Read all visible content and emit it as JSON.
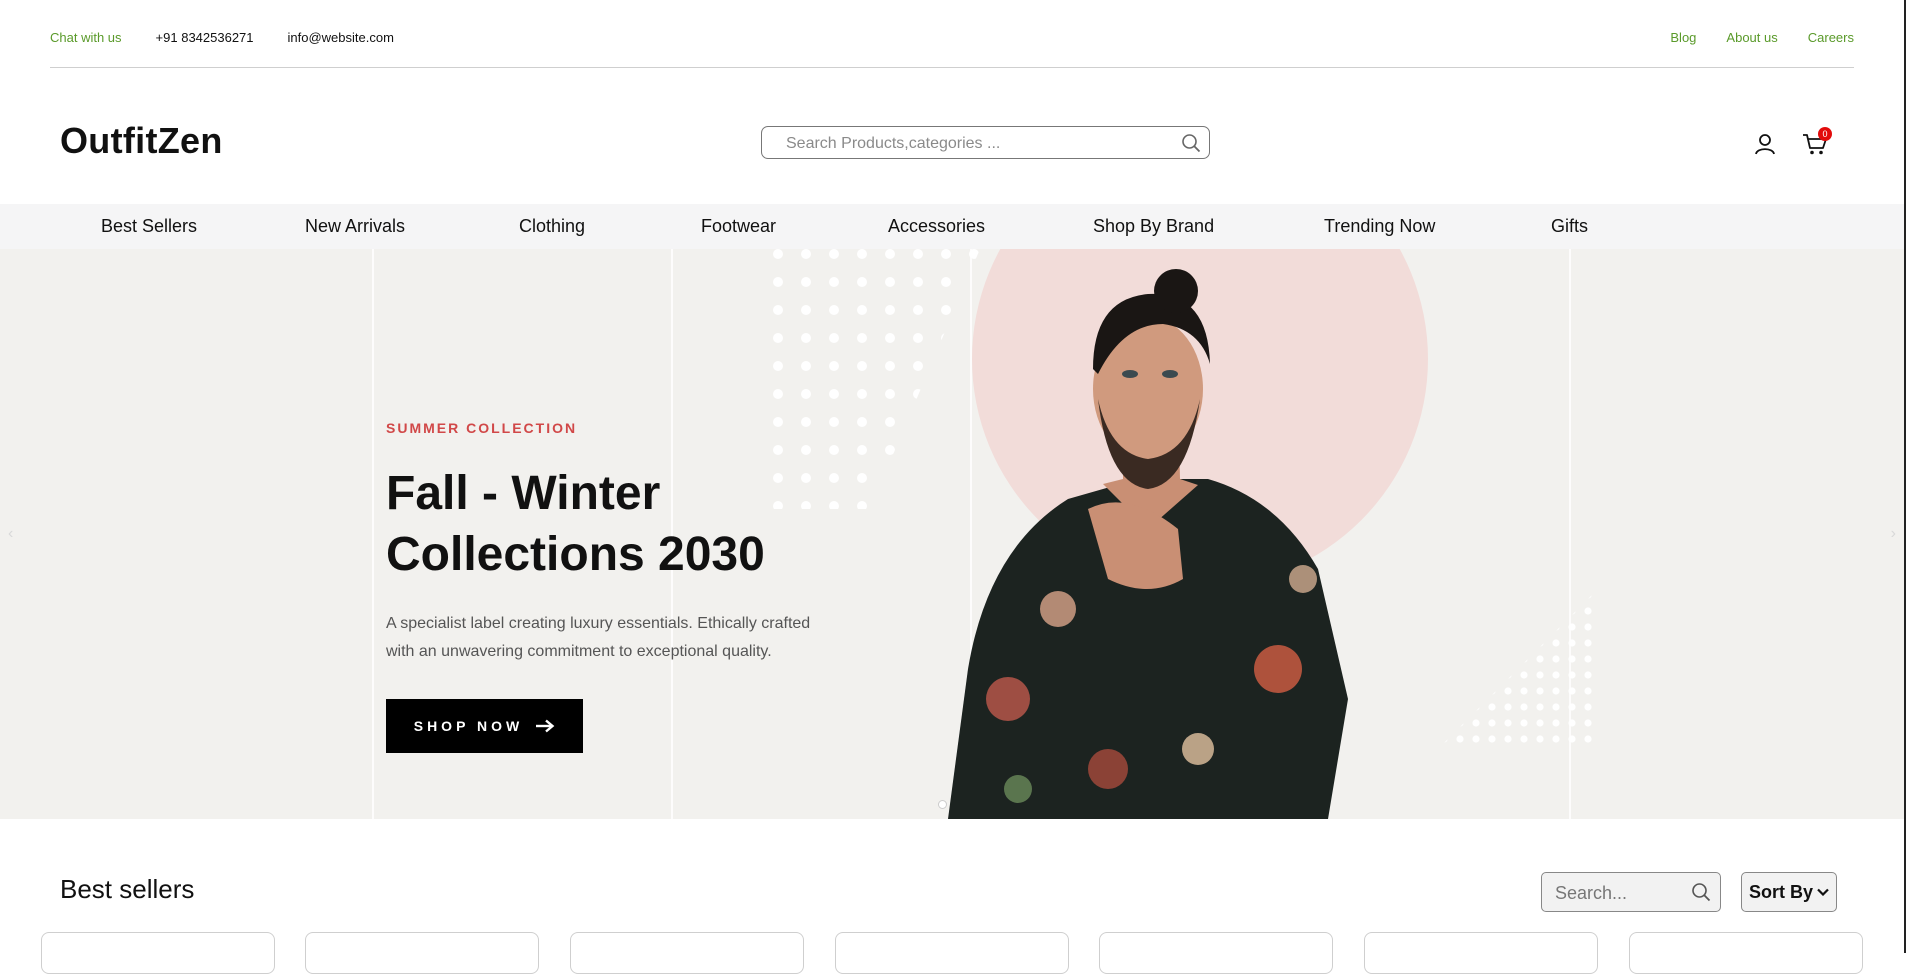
{
  "topbar": {
    "chat": "Chat with us",
    "phone": "+91 8342536271",
    "email": "info@website.com",
    "blog": "Blog",
    "about": "About us",
    "careers": "Careers"
  },
  "header": {
    "logo": "OutfitZen",
    "search_placeholder": "Search Products,categories ...",
    "cart_count": "0"
  },
  "nav": [
    "Best Sellers",
    "New Arrivals",
    "Clothing",
    "Footwear",
    "Accessories",
    "Shop By Brand",
    "Trending Now",
    "Gifts"
  ],
  "hero": {
    "eyebrow": "SUMMER COLLECTION",
    "title_line1": "Fall - Winter",
    "title_line2": "Collections 2030",
    "desc_line1": "A specialist label creating luxury essentials. Ethically crafted",
    "desc_line2": "with an unwavering commitment to exceptional quality.",
    "button": "SHOP NOW",
    "arrow_left": "‹",
    "arrow_right": "›"
  },
  "best_sellers": {
    "title": "Best sellers",
    "search_placeholder": "Search...",
    "sort_label": "Sort By"
  },
  "colors": {
    "accent_green": "#5a9a2a",
    "eyebrow_red": "#d14848",
    "hero_bg": "#f2f1ee",
    "badge_red": "#e20b0b"
  },
  "icons": [
    "search-icon",
    "user-icon",
    "cart-icon",
    "arrow-right-icon",
    "chevron-down-icon"
  ]
}
